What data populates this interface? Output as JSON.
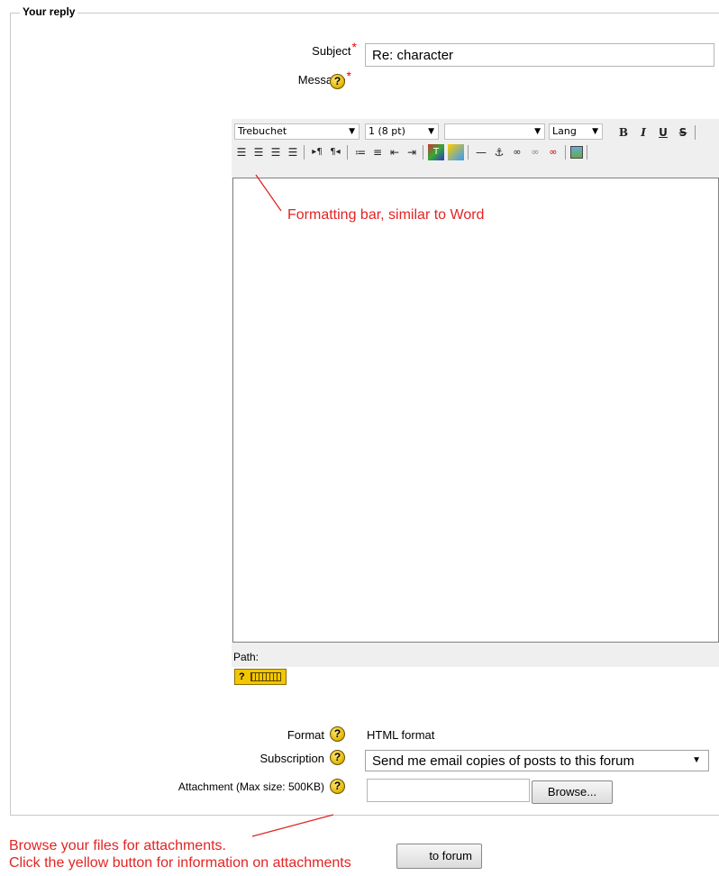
{
  "legend": "Your reply",
  "subject": {
    "label": "Subject",
    "required_mark": "*",
    "value": "Re: character"
  },
  "message": {
    "label": "Message",
    "required_mark": "*",
    "help_icon": "?"
  },
  "toolbar": {
    "font_family": "Trebuchet",
    "font_size": "1 (8 pt)",
    "style": "",
    "lang": "Lang",
    "bold": "B",
    "italic": "I",
    "underline": "U",
    "strike": "S"
  },
  "editor": {
    "path_label": "Path:",
    "keyboard_help_icon": "?"
  },
  "annotation_formatting": "Formatting bar, similar to Word",
  "format": {
    "label": "Format",
    "value": "HTML format"
  },
  "subscription": {
    "label": "Subscription",
    "value": "Send me email copies of posts to this forum"
  },
  "attachment": {
    "label": "Attachment (Max size: 500KB)",
    "browse_label": "Browse..."
  },
  "annotation_browse": {
    "line1": "Browse your files for attachments.",
    "line2": "Click the yellow button for information on attachments"
  },
  "post_button_label": "to forum",
  "colors": {
    "annotation": "#e32424",
    "help_icon": "#e2b400",
    "required": "#e00000"
  }
}
